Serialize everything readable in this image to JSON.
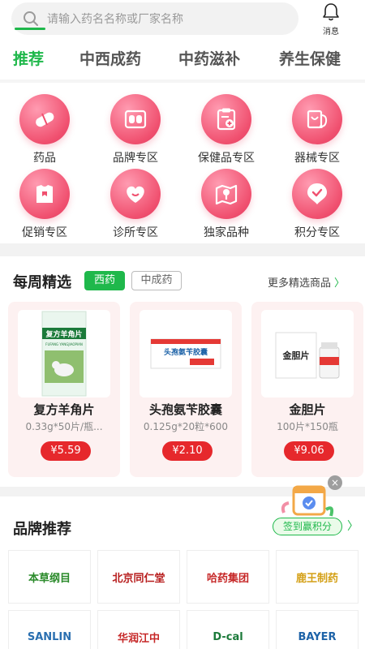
{
  "search": {
    "placeholder": "请输入药名名称或厂家名称"
  },
  "header": {
    "message_label": "消息"
  },
  "tabs": [
    "推荐",
    "中西成药",
    "中药滋补",
    "养生保健"
  ],
  "categories": [
    {
      "label": "药品",
      "icon": "pill-icon"
    },
    {
      "label": "品牌专区",
      "icon": "brand-box-icon"
    },
    {
      "label": "保健品专区",
      "icon": "health-clipboard-icon"
    },
    {
      "label": "器械专区",
      "icon": "stethoscope-icon"
    },
    {
      "label": "促销专区",
      "icon": "promo-shirt-icon"
    },
    {
      "label": "诊所专区",
      "icon": "clinic-heart-icon"
    },
    {
      "label": "独家品种",
      "icon": "map-pin-icon"
    },
    {
      "label": "积分专区",
      "icon": "points-badge-icon"
    }
  ],
  "weekly": {
    "title": "每周精选",
    "filters": [
      "西药",
      "中成药"
    ],
    "more_label": "更多精选商品",
    "products": [
      {
        "name": "复方羊角片",
        "spec": "0.33g*50片/瓶...",
        "price": "¥5.59",
        "box_title": "复方羊角片",
        "box_sub": "FUFANG YANGJIAOPIAN"
      },
      {
        "name": "头孢氨苄胶囊",
        "spec": "0.125g*20粒*600",
        "price": "¥2.10",
        "box_title": "头孢氨苄胶囊",
        "box_sub": ""
      },
      {
        "name": "金胆片",
        "spec": "100片*150瓶",
        "price": "¥9.06",
        "box_title": "金胆片",
        "box_sub": ""
      }
    ]
  },
  "brands": {
    "title": "品牌推荐",
    "logos": [
      {
        "text": "本草纲目",
        "color": "#2a8a2a"
      },
      {
        "text": "北京同仁堂",
        "color": "#b71c1c"
      },
      {
        "text": "哈药集团",
        "color": "#c62828"
      },
      {
        "text": "鹿王制药",
        "color": "#d4a017"
      },
      {
        "text": "SANLIN",
        "color": "#2a6fb0"
      },
      {
        "text": "华润江中",
        "color": "#c62828"
      },
      {
        "text": "D-cal",
        "color": "#1b7a3a"
      },
      {
        "text": "BAYER",
        "color": "#1e63a8"
      }
    ]
  },
  "checkin": {
    "label": "签到赢积分",
    "close": "×"
  },
  "colors": {
    "accent": "#1fb84b",
    "price": "#e6282c",
    "icon_pink": "#f0506f"
  }
}
